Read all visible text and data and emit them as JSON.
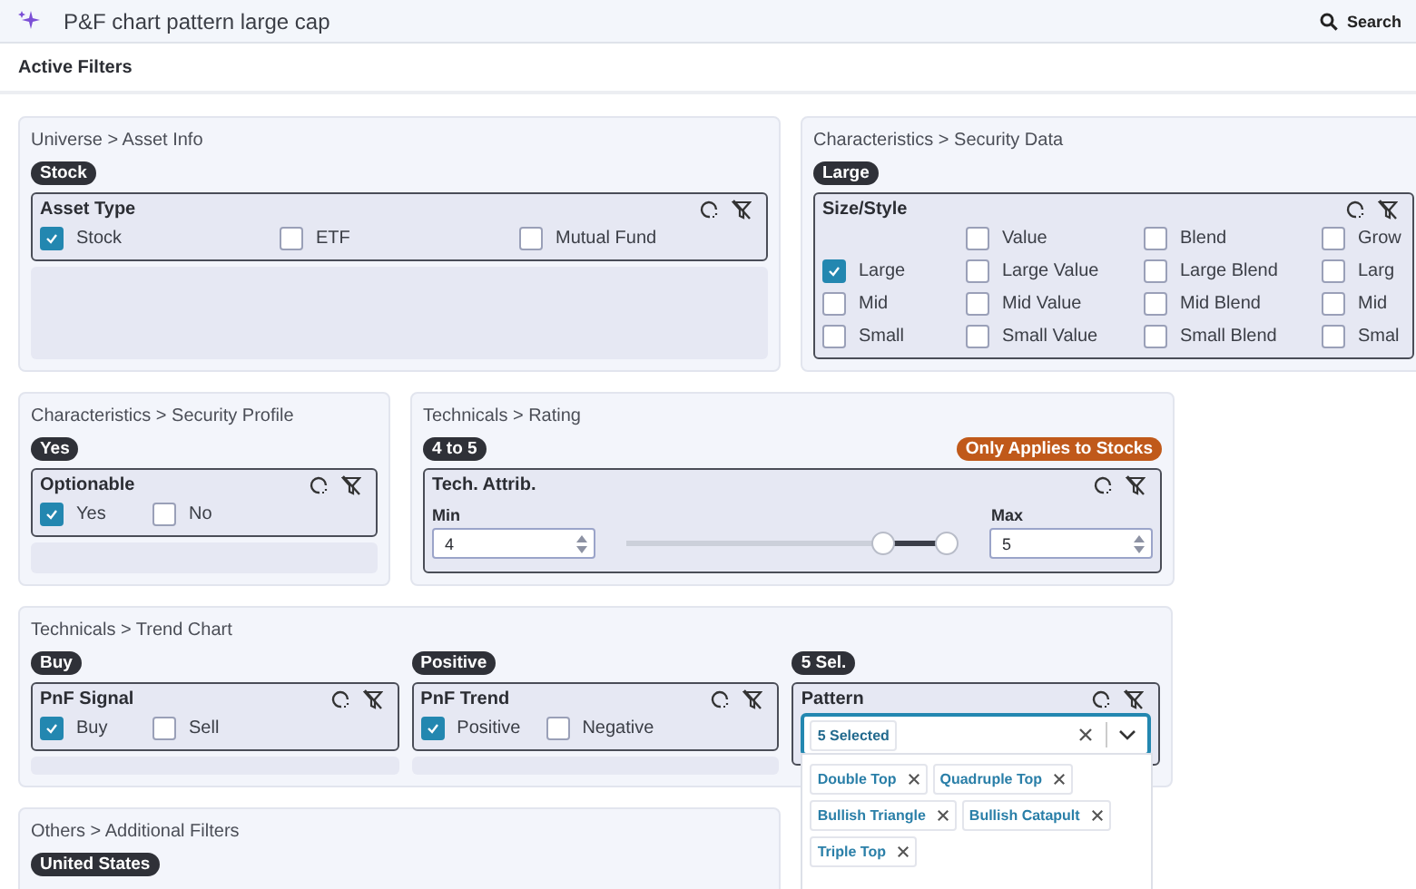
{
  "header": {
    "title": "P&F chart pattern large cap",
    "search_label": "Search"
  },
  "subheader": {
    "title": "Active Filters"
  },
  "rows": [
    [
      {
        "title": "Universe > Asset Info",
        "columns": [
          {
            "badge": "Stock",
            "group": {
              "kind": "checkboxes",
              "title": "Asset Type",
              "options": [
                {
                  "label": "Stock",
                  "checked": true
                },
                {
                  "label": "ETF",
                  "checked": false
                },
                {
                  "label": "Mutual Fund",
                  "checked": false
                }
              ]
            }
          }
        ]
      },
      {
        "title": "Characteristics > Security Data",
        "columns": [
          {
            "badge": "Large",
            "group": {
              "kind": "grid",
              "title": "Size/Style",
              "rows": [
                [
                  "",
                  {
                    "label": "Value",
                    "checked": false
                  },
                  {
                    "label": "Blend",
                    "checked": false
                  },
                  {
                    "label": "Grow",
                    "checked": false
                  }
                ],
                [
                  {
                    "label": "Large",
                    "checked": true
                  },
                  {
                    "label": "Large Value",
                    "checked": false
                  },
                  {
                    "label": "Large Blend",
                    "checked": false
                  },
                  {
                    "label": "Larg",
                    "checked": false
                  }
                ],
                [
                  {
                    "label": "Mid",
                    "checked": false
                  },
                  {
                    "label": "Mid Value",
                    "checked": false
                  },
                  {
                    "label": "Mid Blend",
                    "checked": false
                  },
                  {
                    "label": "Mid",
                    "checked": false
                  }
                ],
                [
                  {
                    "label": "Small",
                    "checked": false
                  },
                  {
                    "label": "Small Value",
                    "checked": false
                  },
                  {
                    "label": "Small Blend",
                    "checked": false
                  },
                  {
                    "label": "Smal",
                    "checked": false
                  }
                ]
              ]
            }
          }
        ]
      }
    ],
    [
      {
        "title": "Characteristics > Security Profile",
        "columns": [
          {
            "badge": "Yes",
            "group": {
              "kind": "checkboxes",
              "title": "Optionable",
              "options": [
                {
                  "label": "Yes",
                  "checked": true
                },
                {
                  "label": "No",
                  "checked": false
                }
              ]
            }
          }
        ]
      },
      {
        "title": "Technicals > Rating",
        "columns": [
          {
            "badge": "4 to 5",
            "note": "Only Applies to Stocks",
            "group": {
              "kind": "range",
              "title": "Tech. Attrib.",
              "min_label": "Min",
              "min_value": "4",
              "max_label": "Max",
              "max_value": "5",
              "thumbs": [
                {
                  "level": 0.8
                },
                {
                  "level": 1
                }
              ]
            }
          }
        ]
      }
    ],
    [
      {
        "title": "Technicals > Trend Chart",
        "columns": [
          {
            "badge": "Buy",
            "group": {
              "kind": "checkboxes",
              "title": "PnF Signal",
              "options": [
                {
                  "label": "Buy",
                  "checked": true
                },
                {
                  "label": "Sell",
                  "checked": false
                }
              ]
            }
          },
          {
            "badge": "Positive",
            "group": {
              "kind": "checkboxes",
              "title": "PnF Trend",
              "options": [
                {
                  "label": "Positive",
                  "checked": true
                },
                {
                  "label": "Negative",
                  "checked": false
                }
              ]
            }
          },
          {
            "badge": "5 Sel.",
            "group": {
              "kind": "multiselect",
              "title": "Pattern",
              "summary": "5 Selected",
              "expanded": true,
              "tags": [
                "Double Top",
                "Quadruple Top",
                "Bullish Triangle",
                "Bullish Catapult",
                "Triple Top"
              ]
            }
          }
        ]
      }
    ],
    [
      {
        "title": "Others > Additional Filters",
        "columns": [
          {
            "badge": "United States"
          }
        ]
      }
    ]
  ]
}
